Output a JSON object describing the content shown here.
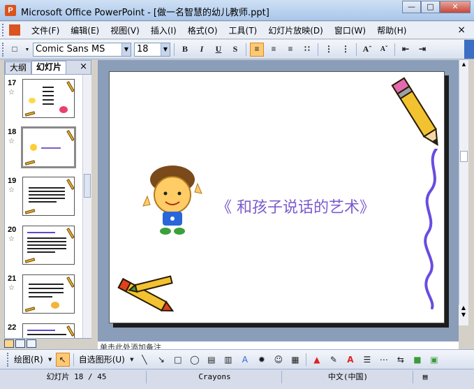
{
  "window": {
    "title": "Microsoft Office PowerPoint - [做一名智慧的幼儿教师.ppt]",
    "app_icon": "powerpoint-icon",
    "buttons": [
      "minimize-icon",
      "maximize-icon",
      "close-icon"
    ]
  },
  "menu": {
    "items": [
      "文件(F)",
      "编辑(E)",
      "视图(V)",
      "插入(I)",
      "格式(O)",
      "工具(T)",
      "幻灯片放映(D)",
      "窗口(W)",
      "帮助(H)"
    ],
    "close": "×"
  },
  "format_toolbar": {
    "font_name": "Comic Sans MS",
    "font_size": "18",
    "bold": "B",
    "italic": "I",
    "underline": "U",
    "shadow": "S",
    "align_left_active": true
  },
  "left_panel": {
    "tabs": [
      "大纲",
      "幻灯片"
    ],
    "active_tab": "幻灯片",
    "close": "×",
    "slides": [
      {
        "num": "17",
        "star": "☆"
      },
      {
        "num": "18",
        "star": "☆",
        "selected": true
      },
      {
        "num": "19",
        "star": "☆"
      },
      {
        "num": "20",
        "star": "☆"
      },
      {
        "num": "21",
        "star": "☆"
      },
      {
        "num": "22",
        "star": ""
      }
    ]
  },
  "slide": {
    "title": "《 和孩子说话的艺术》",
    "title_color": "#7b5ccb"
  },
  "notes": {
    "text": "单击此处添加备注"
  },
  "drawing_toolbar": {
    "draw_label": "绘图(R)",
    "autoshapes_label": "自选图形(U)"
  },
  "status": {
    "slide_info": "幻灯片 18 / 45",
    "design": "Crayons",
    "language": "中文(中国)"
  }
}
